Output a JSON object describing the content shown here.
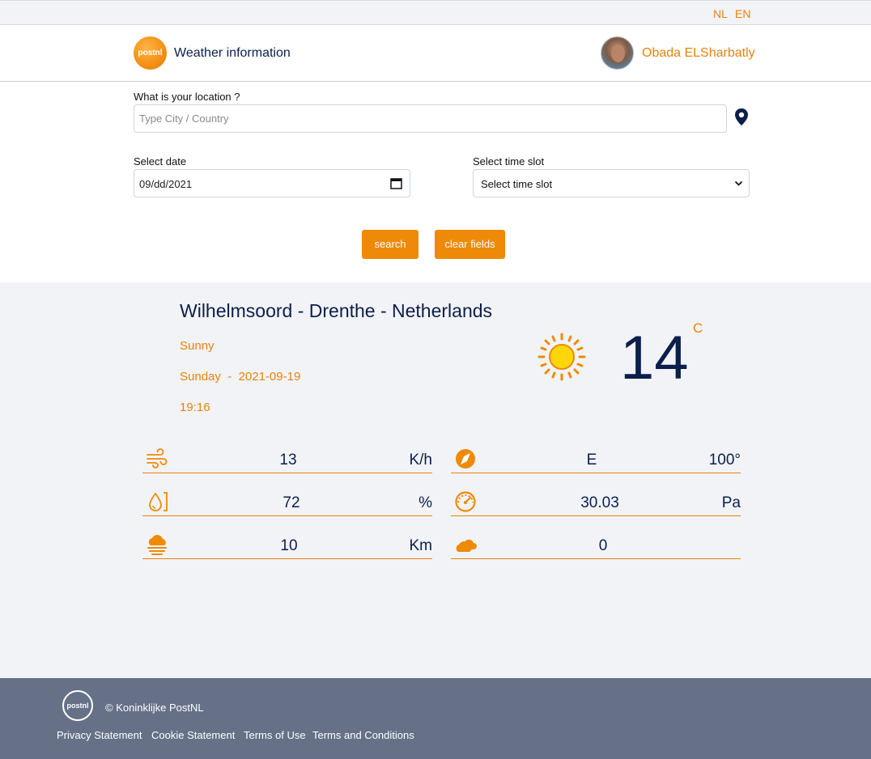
{
  "lang": {
    "nl": "NL",
    "en": "EN"
  },
  "header": {
    "logo_text": "postnl",
    "title": "Weather information",
    "username": "Obada ELSharbatly"
  },
  "form": {
    "location_label": "What is your location ?",
    "location_placeholder": "Type City / Country",
    "date_label": "Select date",
    "date_value": "09/dd/2021",
    "timeslot_label": "Select time slot",
    "timeslot_value": "Select time slot",
    "search_label": "search",
    "clear_label": "clear fields"
  },
  "weather": {
    "location": "Wilhelmsoord - Drenthe - Netherlands",
    "condition": "Sunny",
    "day": "Sunday",
    "separator": "-",
    "date": "2021-09-19",
    "time": "19:16",
    "temperature": "14",
    "temp_unit": "C",
    "condition_icon": "sun-icon"
  },
  "stats": {
    "wind_speed": {
      "icon": "wind-icon",
      "value": "13",
      "unit": "K/h"
    },
    "wind_direction": {
      "icon": "compass-icon",
      "value": "E",
      "unit": "100°"
    },
    "humidity": {
      "icon": "humidity-icon",
      "value": "72",
      "unit": "%"
    },
    "pressure": {
      "icon": "pressure-gauge-icon",
      "value": "30.03",
      "unit": "Pa"
    },
    "visibility": {
      "icon": "fog-icon",
      "value": "10",
      "unit": "Km"
    },
    "cloud_cover": {
      "icon": "cloud-icon",
      "value": "0",
      "unit": ""
    }
  },
  "footer": {
    "logo_text": "postnl",
    "copyright": "© Koninklijke PostNL",
    "links": [
      "Privacy Statement",
      "Cookie Statement",
      "Terms of Use",
      "Terms and Conditions"
    ]
  },
  "colors": {
    "accent": "#e8820c",
    "navy": "#0b1f4b",
    "panel": "#f2f3f7",
    "footer": "#667188"
  }
}
